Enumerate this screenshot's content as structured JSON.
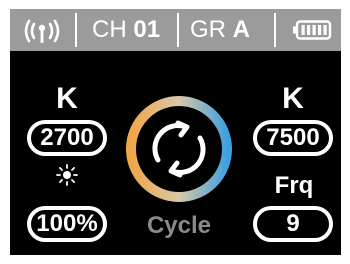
{
  "status_bar": {
    "channel_label": "CH",
    "channel_value": "01",
    "group_label": "GR",
    "group_value": "A",
    "signal_icon": "wireless-signal-icon",
    "battery_icon": "battery-full-icon"
  },
  "left_panel": {
    "kelvin_label": "K",
    "kelvin_value": "2700",
    "brightness_icon": "sun-icon",
    "brightness_value": "100%"
  },
  "center": {
    "cycle_icon": "cycle-arrows-icon",
    "mode_label": "Cycle",
    "ring_colors": [
      "#f0a64a",
      "#3fa0e0"
    ]
  },
  "right_panel": {
    "kelvin_label": "K",
    "kelvin_value": "7500",
    "frequency_label": "Frq",
    "frequency_value": "9"
  },
  "colors": {
    "status_bar_bg": "#9b9b9b",
    "screen_bg": "#000000",
    "text": "#ffffff",
    "muted_label": "#8a8a8a"
  }
}
